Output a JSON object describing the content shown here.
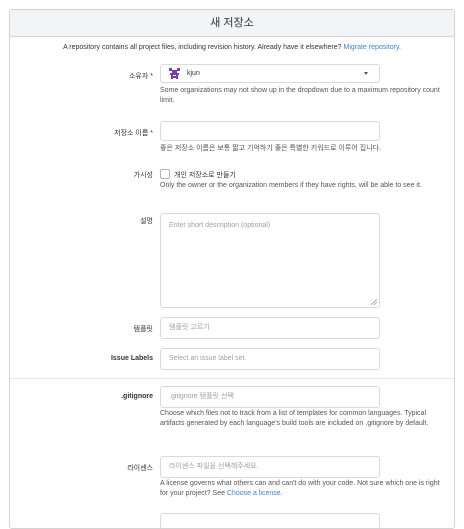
{
  "header": {
    "title": "새 저장소"
  },
  "intro": {
    "text": "A repository contains all project files, including revision history. Already have it elsewhere?",
    "link": "Migrate repository."
  },
  "owner": {
    "label": "소유자",
    "required_mark": "*",
    "value": "kjun",
    "help": "Some organizations may not show up in the dropdown due to a maximum repository count limit."
  },
  "repo_name": {
    "label": "저장소 이름",
    "required_mark": "*",
    "value": "",
    "help": "좋은 저장소 이름은 보통 짧고 기억하기 좋은 특별한 키워드로 이루어 집니다."
  },
  "visibility": {
    "label": "가시성",
    "checkbox_label": "개인 저장소로 만들기",
    "checked": false,
    "help": "Only the owner or the organization members if they have rights, will be able to see it."
  },
  "description": {
    "label": "설명",
    "placeholder": "Enter short description (optional)"
  },
  "template": {
    "label": "템플릿",
    "placeholder": "템플릿 고르기"
  },
  "issue_labels": {
    "label": "Issue Labels",
    "placeholder": "Select an issue label set."
  },
  "gitignore": {
    "label": ".gitignore",
    "placeholder": ".gitignore 템플릿 선택",
    "help": "Choose which files not to track from a list of templates for common languages. Typical artifacts generated by each language's build tools are included on .gitignore by default."
  },
  "license": {
    "label": "라이센스",
    "placeholder": "라이센스 파일을 선택해주세요.",
    "help": "A license governs what others can and can't do with your code. Not sure which one is right for your project? See",
    "help_link": "Choose a license."
  },
  "colors": {
    "accent": "#4183c4",
    "avatar": "#7a3fa6"
  },
  "icons": {
    "owner_avatar": "avatar-icon",
    "dropdown": "chevron-down-icon"
  }
}
